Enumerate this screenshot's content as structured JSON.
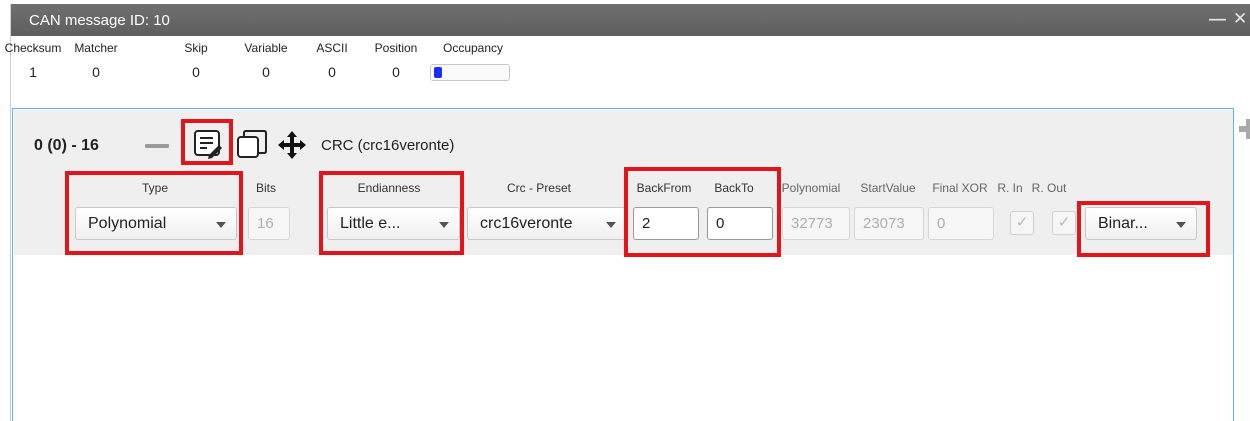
{
  "window": {
    "title": "CAN message ID: 10",
    "controls": [
      "—",
      "✕"
    ]
  },
  "stats": [
    {
      "label": "Checksum",
      "value": "1"
    },
    {
      "label": "Matcher",
      "value": "0"
    },
    {
      "label": "Skip",
      "value": "0"
    },
    {
      "label": "Variable",
      "value": "0"
    },
    {
      "label": "ASCII",
      "value": "0"
    },
    {
      "label": "Position",
      "value": "0"
    },
    {
      "label": "Occupancy",
      "value": ""
    }
  ],
  "occupancy": {
    "fraction": 0.1,
    "color": "#1a2cff"
  },
  "field": {
    "header": "0 (0) - 16",
    "name": "CRC (crc16veronte)",
    "columns": {
      "type": "Type",
      "bits": "Bits",
      "endianness": "Endianness",
      "crc_preset": "Crc - Preset",
      "back_from": "BackFrom",
      "back_to": "BackTo",
      "polynomial": "Polynomial",
      "start_value": "StartValue",
      "final_xor": "Final XOR",
      "r_in": "R. In",
      "r_out": "R. Out"
    },
    "values": {
      "type": "Polynomial",
      "bits": "16",
      "endianness": "Little e...",
      "crc_preset": "crc16veronte",
      "back_from": "2",
      "back_to": "0",
      "polynomial": "32773",
      "start_value": "23073",
      "final_xor": "0",
      "r_in": "✓",
      "r_out": "✓",
      "format": "Binar..."
    }
  },
  "highlight_color": "#e3151a",
  "accent_color": "#5db4e6"
}
